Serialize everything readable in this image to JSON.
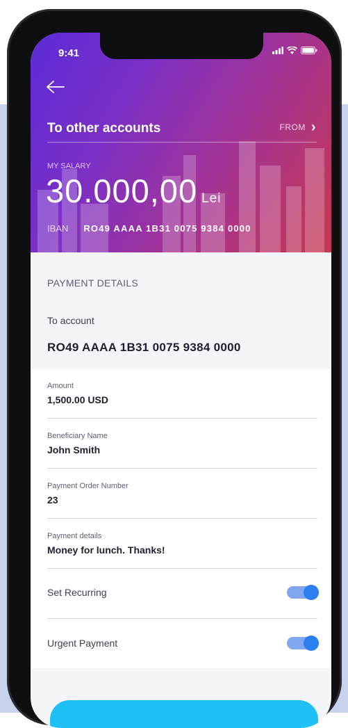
{
  "status_bar": {
    "time": "9:41"
  },
  "header": {
    "title": "To other accounts",
    "from_label": "FROM",
    "account_label": "MY SALARY",
    "balance": "30.000,00",
    "currency": "Lei",
    "iban_label": "IBAN",
    "iban_value": "RO49 AAAA 1B31 0075 9384 0000"
  },
  "payment": {
    "section_title": "PAYMENT DETAILS",
    "to_account_label": "To account",
    "to_account_value": "RO49 AAAA 1B31 0075 9384 0000",
    "fields": [
      {
        "label": "Amount",
        "value": "1,500.00 USD"
      },
      {
        "label": "Beneficiary Name",
        "value": "John Smith"
      },
      {
        "label": "Payment Order Number",
        "value": "23"
      },
      {
        "label": "Payment details",
        "value": "Money for lunch. Thanks!"
      }
    ],
    "toggles": [
      {
        "label": "Set Recurring",
        "on": true
      },
      {
        "label": "Urgent Payment",
        "on": true
      }
    ]
  },
  "colors": {
    "gradient_start": "#5b2bd6",
    "gradient_end": "#c8384f",
    "toggle_on": "#2c7ff0",
    "primary_button": "#1ec0f5"
  }
}
